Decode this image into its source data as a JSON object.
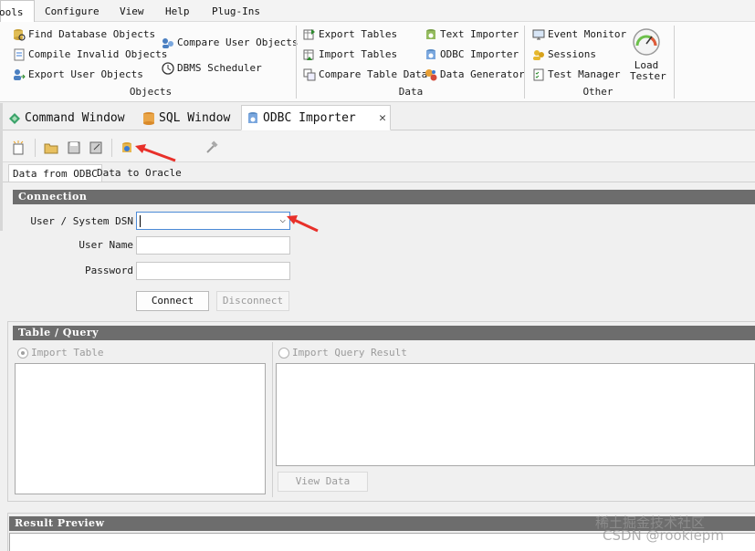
{
  "menu": {
    "tools": "ools",
    "configure": "Configure",
    "view": "View",
    "help": "Help",
    "plugins": "Plug-Ins"
  },
  "ribbon": {
    "objects": {
      "label": "Objects",
      "find_db_objects": "Find Database Objects",
      "compile_invalid": "Compile Invalid Objects",
      "export_user_objects": "Export User Objects",
      "compare_user_objects": "Compare User Objects",
      "dbms_scheduler": "DBMS Scheduler"
    },
    "data": {
      "label": "Data",
      "export_tables": "Export Tables",
      "import_tables": "Import Tables",
      "compare_table_data": "Compare Table Data",
      "text_importer": "Text Importer",
      "odbc_importer": "ODBC Importer",
      "data_generator": "Data Generator"
    },
    "other": {
      "label": "Other",
      "event_monitor": "Event Monitor",
      "sessions": "Sessions",
      "test_manager": "Test Manager",
      "load_tester_line1": "Load",
      "load_tester_line2": "Tester"
    }
  },
  "tabs": {
    "command_window": "Command Window",
    "sql_window": "SQL Window",
    "odbc_importer": "ODBC Importer",
    "close_glyph": "✕"
  },
  "inner_tabs": {
    "data_from_odbc": "Data from ODBC",
    "data_to_oracle": "Data to Oracle"
  },
  "connection": {
    "title": "Connection",
    "dsn_label": "User / System DSN",
    "dsn_value": "",
    "username_label": "User Name",
    "username_value": "",
    "password_label": "Password",
    "password_value": "",
    "connect": "Connect",
    "disconnect": "Disconnect"
  },
  "table_query": {
    "title": "Table / Query",
    "import_table": "Import Table",
    "import_query_result": "Import Query Result",
    "view_data": "View Data"
  },
  "result_preview": {
    "title": "Result Preview"
  },
  "watermark": {
    "line1": "稀土掘金技术社区",
    "line2": "CSDN @rookiepm"
  },
  "colors": {
    "section_bar": "#6d6d6d",
    "red_annotation": "#e8302a"
  }
}
